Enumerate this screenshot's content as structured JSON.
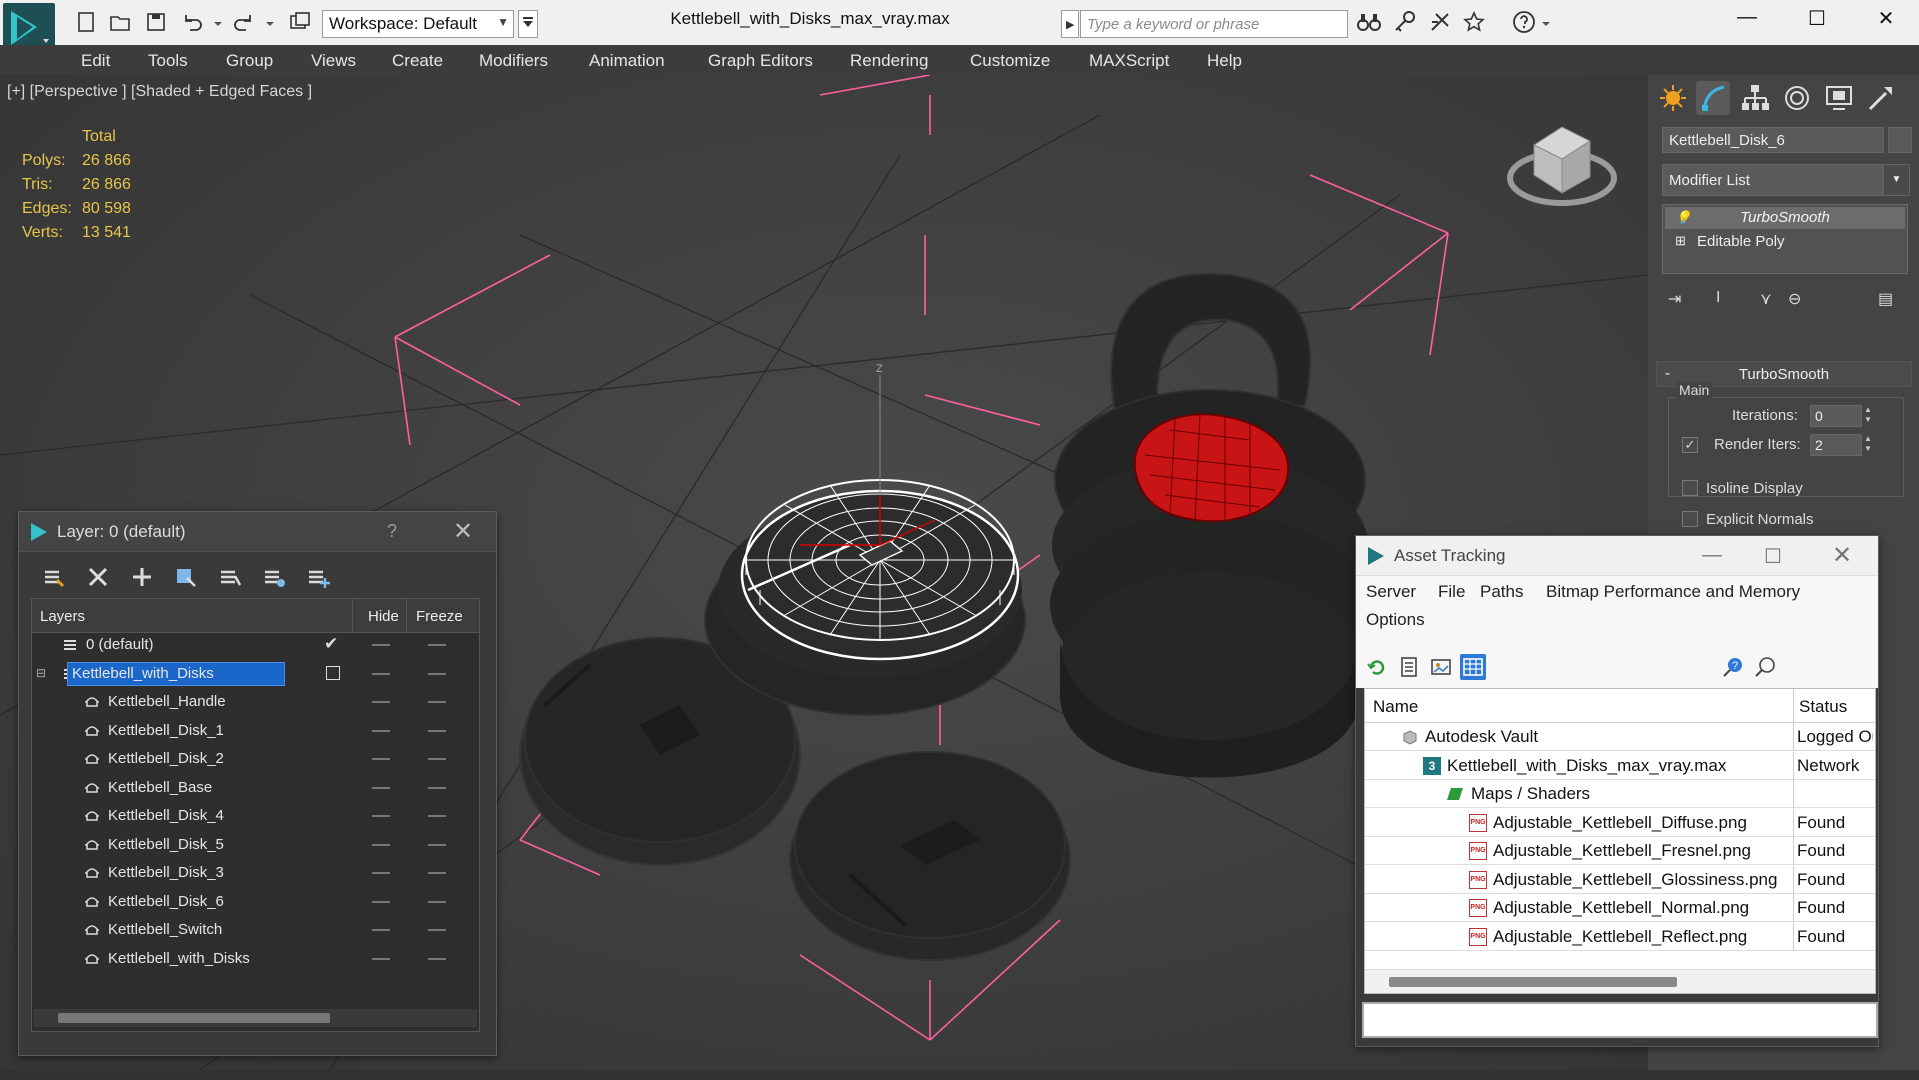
{
  "titlebar": {
    "workspace_label": "Workspace: Default",
    "file_title": "Kettlebell_with_Disks_max_vray.max",
    "search_placeholder": "Type a keyword or phrase"
  },
  "menu": [
    "Edit",
    "Tools",
    "Group",
    "Views",
    "Create",
    "Modifiers",
    "Animation",
    "Graph Editors",
    "Rendering",
    "Customize",
    "MAXScript",
    "Help"
  ],
  "viewport": {
    "label": "[+] [Perspective ] [Shaded + Edged Faces ]",
    "stats": {
      "header": "Total",
      "rows": [
        {
          "k": "Polys:",
          "v": "26 866"
        },
        {
          "k": "Tris:",
          "v": "26 866"
        },
        {
          "k": "Edges:",
          "v": "80 598"
        },
        {
          "k": "Verts:",
          "v": "13 541"
        }
      ]
    },
    "axis_label": "Z",
    "accent_color": "#d80000",
    "selection_color": "#ff5fa0"
  },
  "command_panel": {
    "object_name": "Kettlebell_Disk_6",
    "modifier_list": "Modifier List",
    "stack": [
      "TurboSmooth",
      "Editable Poly"
    ],
    "rollout_title": "TurboSmooth",
    "group_label": "Main",
    "iterations_label": "Iterations:",
    "iterations_value": "0",
    "render_iters_label": "Render Iters:",
    "render_iters_value": "2",
    "render_iters_checked": "✓",
    "isoline_label": "Isoline Display",
    "explicit_normals_label": "Explicit Normals"
  },
  "layer_panel": {
    "title": "Layer: 0 (default)",
    "help": "?",
    "columns": {
      "layers": "Layers",
      "hide": "Hide",
      "freeze": "Freeze"
    },
    "rows": [
      {
        "name": "0 (default)",
        "level": 0
      },
      {
        "name": "Kettlebell_with_Disks",
        "level": 0
      },
      {
        "name": "Kettlebell_Handle",
        "level": 1
      },
      {
        "name": "Kettlebell_Disk_1",
        "level": 1
      },
      {
        "name": "Kettlebell_Disk_2",
        "level": 1
      },
      {
        "name": "Kettlebell_Base",
        "level": 1
      },
      {
        "name": "Kettlebell_Disk_4",
        "level": 1
      },
      {
        "name": "Kettlebell_Disk_5",
        "level": 1
      },
      {
        "name": "Kettlebell_Disk_3",
        "level": 1
      },
      {
        "name": "Kettlebell_Disk_6",
        "level": 1
      },
      {
        "name": "Kettlebell_Switch",
        "level": 1
      },
      {
        "name": "Kettlebell_with_Disks",
        "level": 1
      }
    ]
  },
  "asset_panel": {
    "title": "Asset Tracking",
    "menu": [
      "Server",
      "File",
      "Paths",
      "Bitmap Performance and Memory",
      "Options"
    ],
    "columns": {
      "name": "Name",
      "status": "Status"
    },
    "rows": [
      {
        "name": "Autodesk Vault",
        "status": "Logged Out"
      },
      {
        "name": "Kettlebell_with_Disks_max_vray.max",
        "status": "Network"
      },
      {
        "name": "Maps / Shaders",
        "status": ""
      },
      {
        "name": "Adjustable_Kettlebell_Diffuse.png",
        "status": "Found"
      },
      {
        "name": "Adjustable_Kettlebell_Fresnel.png",
        "status": "Found"
      },
      {
        "name": "Adjustable_Kettlebell_Glossiness.png",
        "status": "Found"
      },
      {
        "name": "Adjustable_Kettlebell_Normal.png",
        "status": "Found"
      },
      {
        "name": "Adjustable_Kettlebell_Reflect.png",
        "status": "Found"
      }
    ],
    "png_badge": "PNG",
    "max_badge": "3"
  }
}
